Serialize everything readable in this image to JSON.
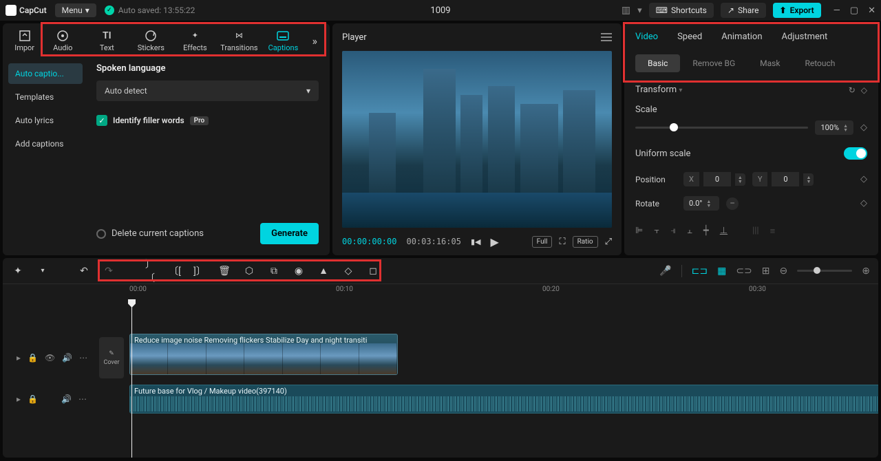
{
  "topbar": {
    "logo": "CapCut",
    "menu": "Menu",
    "autosave": "Auto saved: 13:55:22",
    "project": "1009",
    "shortcuts": "Shortcuts",
    "share": "Share",
    "export": "Export"
  },
  "medianav": {
    "import": "Impor",
    "items": [
      "Audio",
      "Text",
      "Stickers",
      "Effects",
      "Transitions",
      "Captions"
    ]
  },
  "leftsub": {
    "items": [
      "Auto captio...",
      "Templates",
      "Auto lyrics",
      "Add captions"
    ]
  },
  "captions": {
    "langlabel": "Spoken language",
    "langvalue": "Auto detect",
    "filler": "Identify filler words",
    "pro": "Pro",
    "delete": "Delete current captions",
    "generate": "Generate"
  },
  "player": {
    "title": "Player",
    "tc_current": "00:00:00:00",
    "tc_total": "00:03:16:05",
    "full": "Full",
    "ratio": "Ratio"
  },
  "right": {
    "tabs": [
      "Video",
      "Speed",
      "Animation",
      "Adjustment"
    ],
    "subtabs": [
      "Basic",
      "Remove BG",
      "Mask",
      "Retouch"
    ],
    "transform": "Transform",
    "scale": "Scale",
    "scaleval": "100%",
    "uniform": "Uniform scale",
    "position": "Position",
    "posx": "X",
    "posxval": "0",
    "posy": "Y",
    "posyval": "0",
    "rotate": "Rotate",
    "rotateval": "0.0°"
  },
  "ruler": {
    "t0": "00:00",
    "t1": "00:10",
    "t2": "00:20",
    "t3": "00:30"
  },
  "tracks": {
    "cover": "Cover",
    "vclip": "Reduce image noise   Removing flickers   Stabilize   Day and night transiti",
    "aclip": "Future base for Vlog / Makeup video(397140)"
  }
}
